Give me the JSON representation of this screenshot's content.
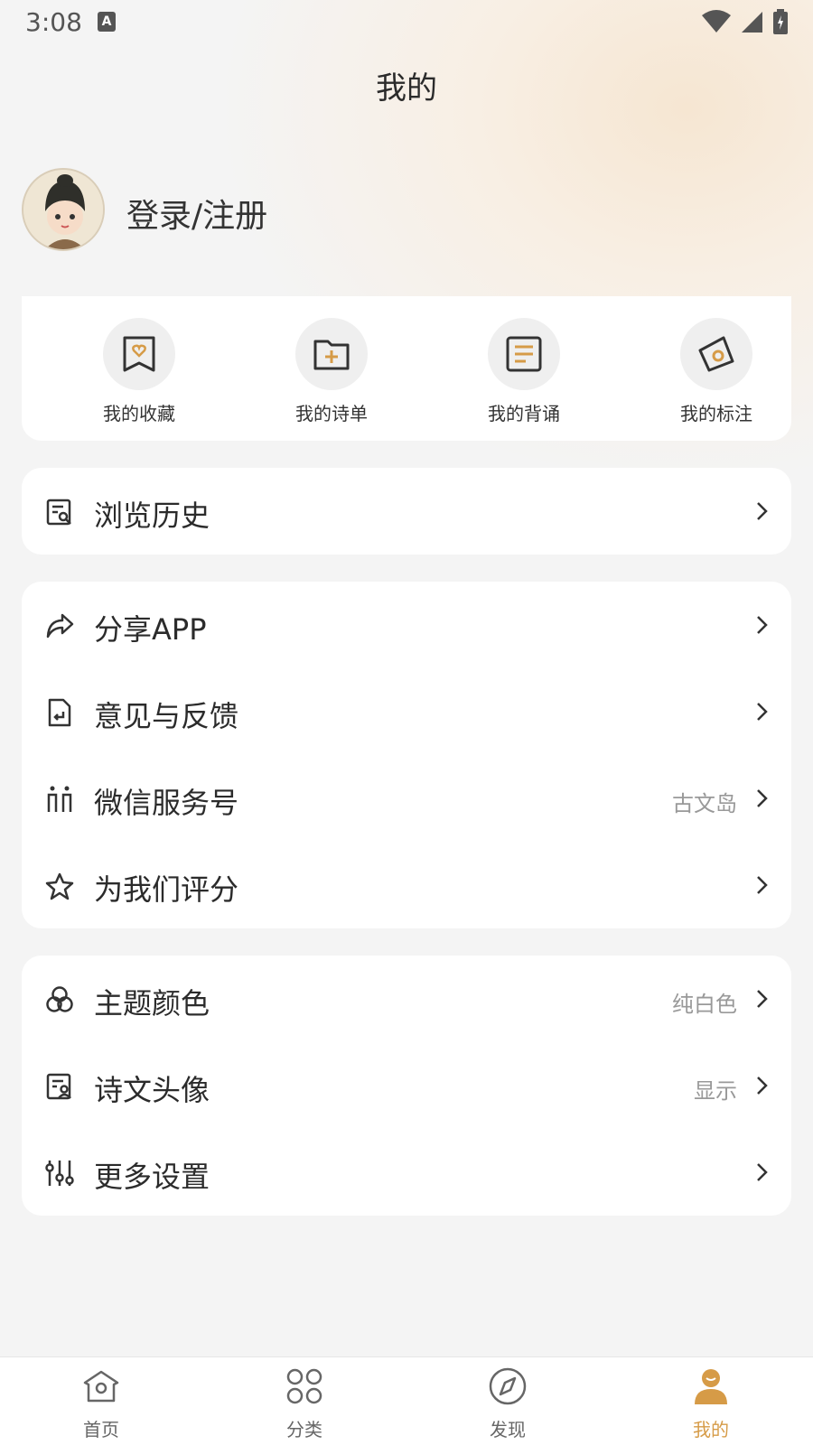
{
  "status_bar": {
    "time": "3:08",
    "notif_icon": "a-icon"
  },
  "header": {
    "title": "我的"
  },
  "profile": {
    "login_label": "登录/注册"
  },
  "quick_actions": [
    {
      "label": "我的收藏",
      "icon": "heart-bookmark-icon"
    },
    {
      "label": "我的诗单",
      "icon": "folder-plus-icon"
    },
    {
      "label": "我的背诵",
      "icon": "document-lines-icon"
    },
    {
      "label": "我的标注",
      "icon": "tag-icon"
    }
  ],
  "section1": [
    {
      "label": "浏览历史",
      "icon": "history-icon"
    }
  ],
  "section2": [
    {
      "label": "分享APP",
      "icon": "share-icon"
    },
    {
      "label": "意见与反馈",
      "icon": "feedback-icon"
    },
    {
      "label": "微信服务号",
      "icon": "wechat-service-icon",
      "value": "古文岛"
    },
    {
      "label": "为我们评分",
      "icon": "star-icon"
    }
  ],
  "section3": [
    {
      "label": "主题颜色",
      "icon": "theme-color-icon",
      "value": "纯白色"
    },
    {
      "label": "诗文头像",
      "icon": "poem-avatar-icon",
      "value": "显示"
    },
    {
      "label": "更多设置",
      "icon": "sliders-icon"
    }
  ],
  "bottom_nav": [
    {
      "label": "首页",
      "icon": "home-icon"
    },
    {
      "label": "分类",
      "icon": "category-icon"
    },
    {
      "label": "发现",
      "icon": "compass-icon"
    },
    {
      "label": "我的",
      "icon": "user-icon",
      "active": true
    }
  ],
  "colors": {
    "accent": "#d69b47",
    "background": "#f4f4f4",
    "card": "#ffffff"
  }
}
